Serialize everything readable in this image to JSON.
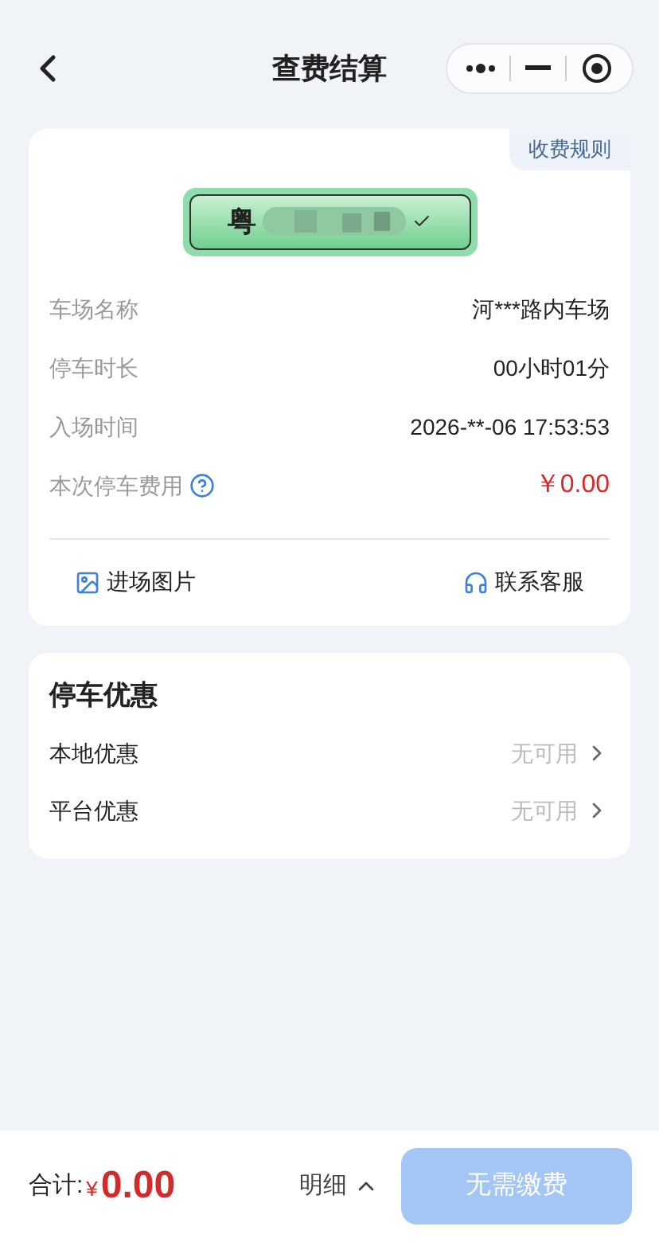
{
  "header": {
    "title": "查费结算"
  },
  "fee_rules_link": "收费规则",
  "plate": {
    "prefix": "粤",
    "masked": true,
    "selected": true
  },
  "details": [
    {
      "label": "车场名称",
      "value": "河***路内车场",
      "kind": "plain"
    },
    {
      "label": "停车时长",
      "value": "00小时01分",
      "kind": "plain"
    },
    {
      "label": "入场时间",
      "value": "2026-**-06 17:53:53",
      "kind": "plain"
    },
    {
      "label": "本次停车费用",
      "value": "￥0.00",
      "kind": "fee"
    }
  ],
  "actions": [
    {
      "label": "进场图片",
      "kind": "image"
    },
    {
      "label": "联系客服",
      "kind": "service"
    }
  ],
  "discounts": {
    "title": "停车优惠",
    "items": [
      {
        "label": "本地优惠",
        "status": "无可用",
        "disabled": true
      },
      {
        "label": "平台优惠",
        "status": "无可用",
        "disabled": true
      }
    ]
  },
  "footer": {
    "total_label": "合计:",
    "currency": "¥",
    "amount": "0.00",
    "detail_link": "明细",
    "expanded": false,
    "pay_button": "无需缴费",
    "pay_disabled": true
  }
}
